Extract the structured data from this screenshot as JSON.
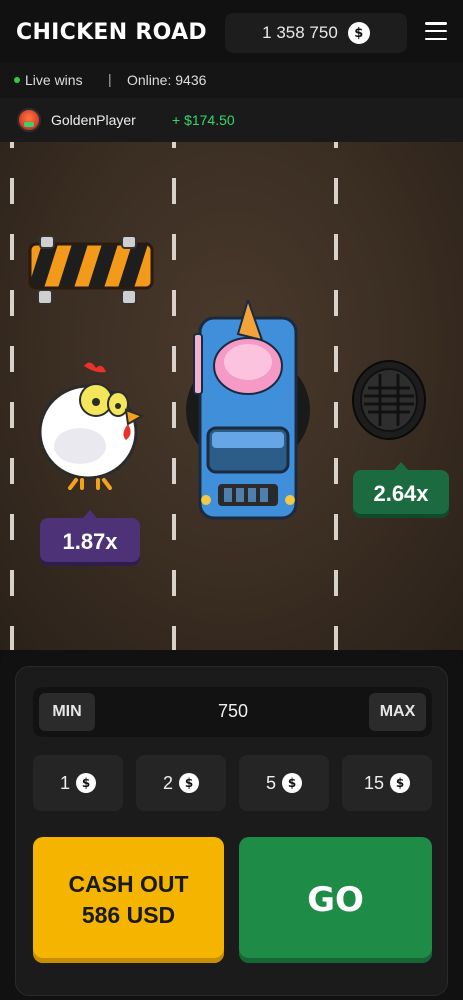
{
  "header": {
    "logo": "CHICKEN ROAD",
    "balance": "1 358 750",
    "currency_symbol": "$"
  },
  "info": {
    "live_label": "Live wins",
    "separator": "|",
    "online_label": "Online: 9436"
  },
  "latest_win": {
    "player": "GoldenPlayer",
    "amount": "+ $174.50"
  },
  "road": {
    "multipliers": [
      {
        "value": "1.87x",
        "state": "current",
        "color": "#4d3278"
      },
      {
        "value": "2.64x",
        "state": "next",
        "color": "#1c6b40"
      }
    ]
  },
  "controls": {
    "min_label": "MIN",
    "max_label": "MAX",
    "bet_value": "750",
    "quick_bets": [
      "1",
      "2",
      "5",
      "15"
    ],
    "cashout_line1": "CASH OUT",
    "cashout_line2": "586 USD",
    "go_label": "GO"
  },
  "colors": {
    "accent_yellow": "#f4b400",
    "accent_green": "#1e8c47",
    "win_green": "#35d86a"
  }
}
